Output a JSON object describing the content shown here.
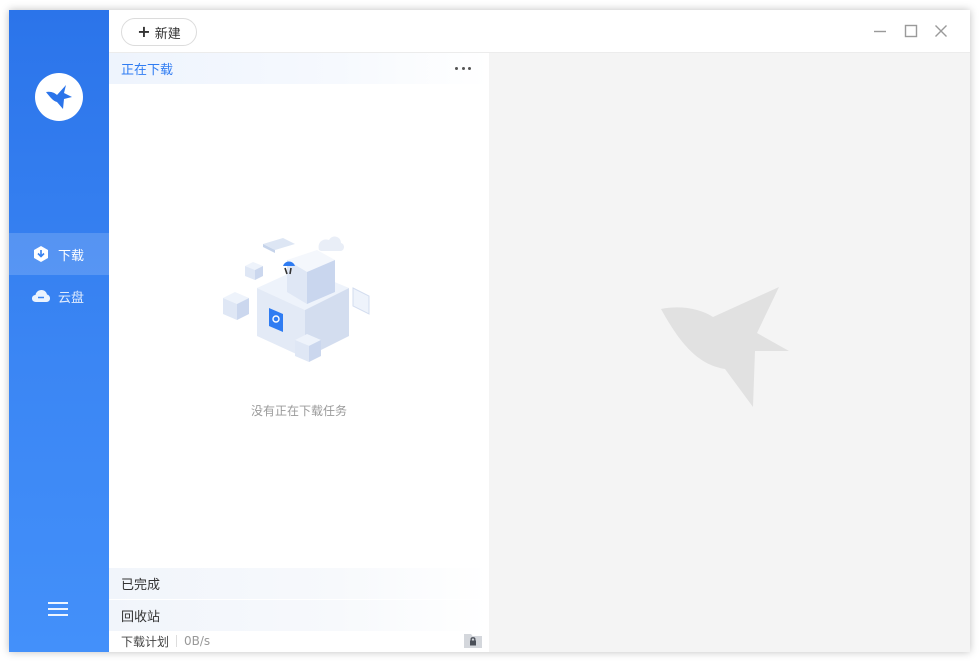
{
  "toolbar": {
    "new_label": "新建"
  },
  "sidebar": {
    "items": [
      {
        "label": "下载",
        "icon": "download-icon",
        "active": true
      },
      {
        "label": "云盘",
        "icon": "cloud-icon",
        "active": false
      }
    ]
  },
  "downloads": {
    "active_section": "正在下载",
    "empty_text": "没有正在下载任务",
    "completed_section": "已完成",
    "recycle_section": "回收站"
  },
  "status": {
    "plan_label": "下载计划",
    "speed": "0B/s"
  },
  "colors": {
    "accent": "#2f7cf2",
    "sidebar_top": "#2b74ea",
    "sidebar_bottom": "#4390fa",
    "detail_bg": "#f4f4f4"
  }
}
